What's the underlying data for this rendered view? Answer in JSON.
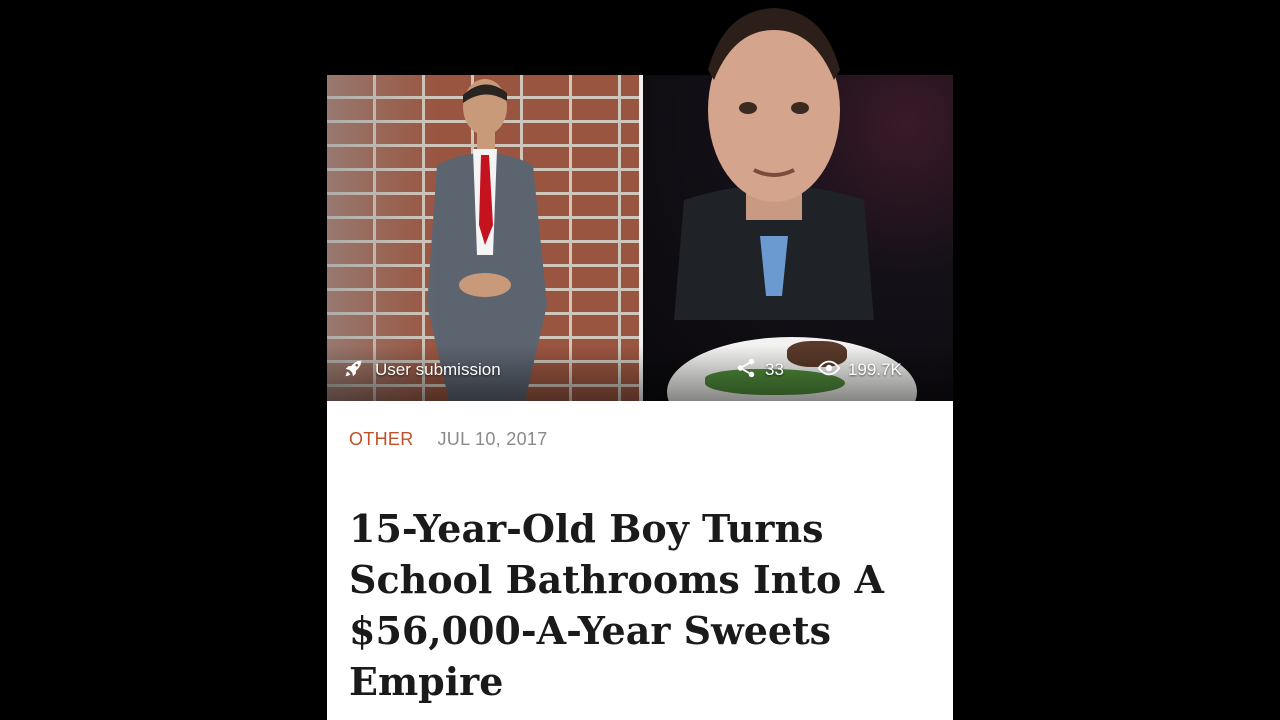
{
  "article": {
    "category": "OTHER",
    "date": "JUL 10, 2017",
    "headline": "15-Year-Old Boy Turns School Bathrooms Into A $56,000-A-Year Sweets Empire"
  },
  "hero": {
    "submission_label": "User submission",
    "shares": "33",
    "views": "199.7K"
  },
  "icons": {
    "submission": "rocket-icon",
    "shares": "share-icon",
    "views": "eye-icon"
  },
  "colors": {
    "category": "#c0502a",
    "date": "#8a8a8a",
    "headline": "#1a1a1a",
    "background": "#000000"
  }
}
